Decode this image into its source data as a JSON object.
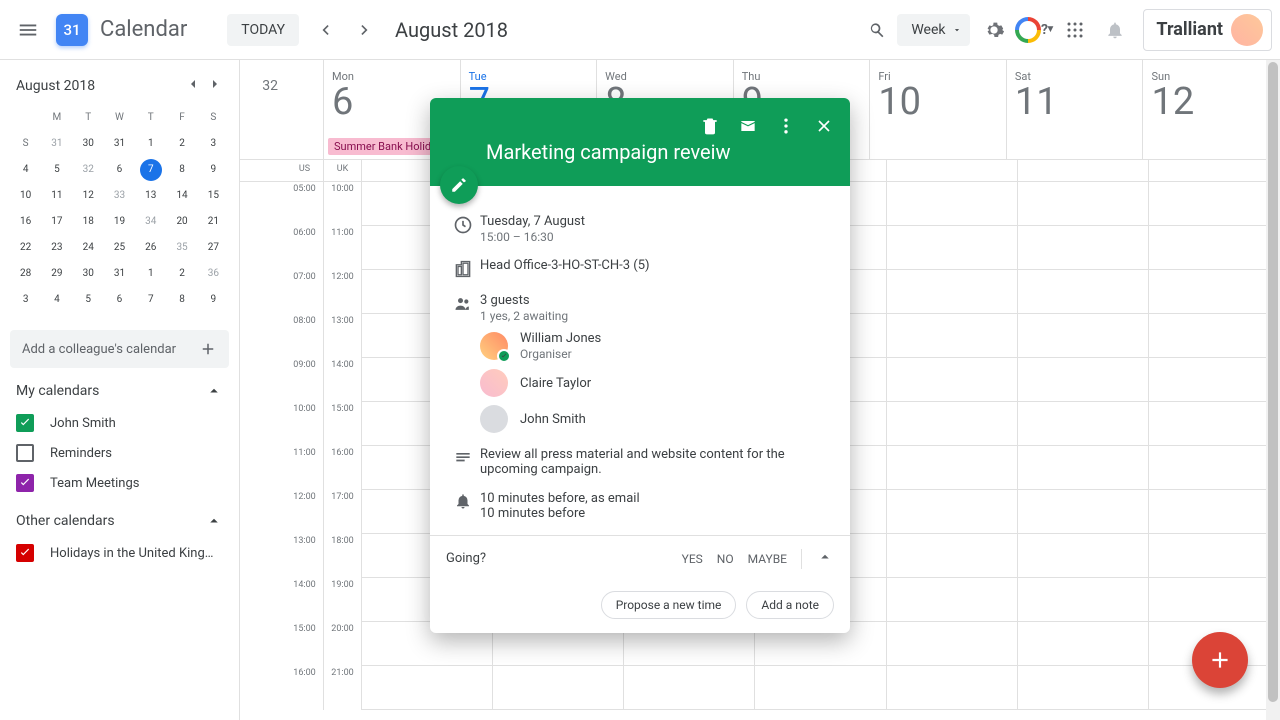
{
  "header": {
    "app_name": "Calendar",
    "logo_day": "31",
    "today_btn": "TODAY",
    "title": "August 2018",
    "view": "Week",
    "profile_name": "Tralliant"
  },
  "mini": {
    "month": "August 2018",
    "dow": [
      "M",
      "T",
      "W",
      "T",
      "F",
      "S",
      "S"
    ],
    "weeks": [
      {
        "wk": "31",
        "days": [
          "30",
          "31",
          "1",
          "2",
          "3",
          "4",
          "5"
        ]
      },
      {
        "wk": "32",
        "days": [
          "6",
          "7",
          "8",
          "9",
          "10",
          "11",
          "12"
        ]
      },
      {
        "wk": "33",
        "days": [
          "13",
          "14",
          "15",
          "16",
          "17",
          "18",
          "19"
        ]
      },
      {
        "wk": "34",
        "days": [
          "20",
          "21",
          "22",
          "23",
          "24",
          "25",
          "26"
        ]
      },
      {
        "wk": "35",
        "days": [
          "27",
          "28",
          "29",
          "30",
          "31",
          "1",
          "2"
        ]
      },
      {
        "wk": "36",
        "days": [
          "3",
          "4",
          "5",
          "6",
          "7",
          "8",
          "9"
        ]
      }
    ],
    "today_index": [
      1,
      1
    ]
  },
  "add_colleague": "Add a colleague's calendar",
  "my_cal_hdr": "My calendars",
  "other_cal_hdr": "Other calendars",
  "my_cals": [
    {
      "name": "John Smith",
      "color": "#0f9d58",
      "checked": true
    },
    {
      "name": "Reminders",
      "color": "#5f6368",
      "checked": false
    },
    {
      "name": "Team Meetings",
      "color": "#8e24aa",
      "checked": true
    }
  ],
  "other_cals": [
    {
      "name": "Holidays in the United King…",
      "color": "#d50000",
      "checked": true
    }
  ],
  "week": {
    "wn": "32",
    "tz": [
      "US",
      "UK"
    ],
    "days": [
      {
        "dow": "Mon",
        "num": "6",
        "today": false,
        "allday": "Summer Bank Holiday"
      },
      {
        "dow": "Tue",
        "num": "7",
        "today": true
      },
      {
        "dow": "Wed",
        "num": "8",
        "today": false
      },
      {
        "dow": "Thu",
        "num": "9",
        "today": false
      },
      {
        "dow": "Fri",
        "num": "10",
        "today": false
      },
      {
        "dow": "Sat",
        "num": "11",
        "today": false
      },
      {
        "dow": "Sun",
        "num": "12",
        "today": false
      }
    ],
    "hours": [
      [
        "05:00",
        "10:00"
      ],
      [
        "06:00",
        "11:00"
      ],
      [
        "07:00",
        "12:00"
      ],
      [
        "08:00",
        "13:00"
      ],
      [
        "09:00",
        "14:00"
      ],
      [
        "10:00",
        "15:00"
      ],
      [
        "11:00",
        "16:00"
      ],
      [
        "12:00",
        "17:00"
      ],
      [
        "13:00",
        "18:00"
      ],
      [
        "14:00",
        "19:00"
      ],
      [
        "15:00",
        "20:00"
      ],
      [
        "16:00",
        "21:00"
      ]
    ]
  },
  "event": {
    "title": "Marketing campaign reveiw",
    "date": "Tuesday, 7 August",
    "time": "15:00 – 16:30",
    "room": "Head Office-3-HO-ST-CH-3 (5)",
    "guests_count": "3 guests",
    "guests_status": "1 yes, 2 awaiting",
    "guests": [
      {
        "name": "William Jones",
        "sub": "Organiser",
        "badge": true,
        "avbg": "linear-gradient(45deg,#ffd180,#ff8a65)"
      },
      {
        "name": "Claire Taylor",
        "sub": "",
        "badge": false,
        "avbg": "linear-gradient(45deg,#f8bbd0,#ffccbc)"
      },
      {
        "name": "John Smith",
        "sub": "",
        "badge": false,
        "avbg": "#dadce0"
      }
    ],
    "desc": "Review all press material and website content for the upcoming campaign.",
    "reminder1": "10 minutes before, as email",
    "reminder2": "10 minutes before",
    "going": "Going?",
    "yes": "YES",
    "no": "NO",
    "maybe": "MAYBE",
    "propose": "Propose a new time",
    "add_note": "Add a note"
  }
}
